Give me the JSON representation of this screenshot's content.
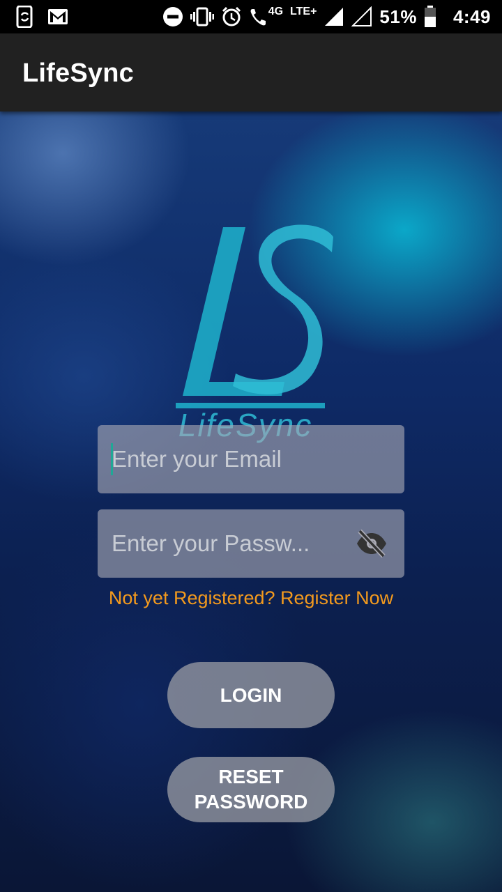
{
  "status_bar": {
    "network_label": "4G",
    "lte_label": "LTE+",
    "battery": "51%",
    "time": "4:49"
  },
  "app_bar": {
    "title": "LifeSync"
  },
  "logo": {
    "monogram": "LS",
    "wordmark": "LifeSync"
  },
  "form": {
    "email_placeholder": "Enter your Email",
    "email_value": "",
    "password_placeholder": "Enter your Passw...",
    "password_value": "",
    "register_link": "Not yet Registered? Register Now"
  },
  "buttons": {
    "login": "LOGIN",
    "reset_line1": "RESET",
    "reset_line2": "PASSWORD"
  },
  "colors": {
    "accent": "#f39a1e",
    "logo": "#1fb3cc",
    "cursor": "#1fa896"
  }
}
